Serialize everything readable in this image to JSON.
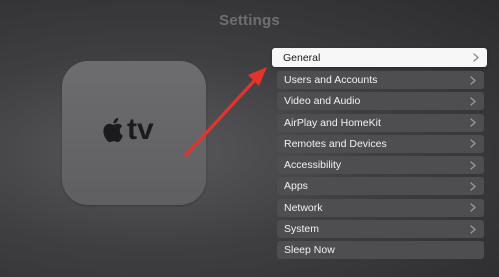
{
  "header": {
    "title": "Settings"
  },
  "device": {
    "text": "tv",
    "logo_icon": "apple-logo-icon"
  },
  "menu": {
    "items": [
      {
        "label": "General",
        "selected": true,
        "has_chevron": true
      },
      {
        "label": "Users and Accounts",
        "selected": false,
        "has_chevron": true
      },
      {
        "label": "Video and Audio",
        "selected": false,
        "has_chevron": true
      },
      {
        "label": "AirPlay and HomeKit",
        "selected": false,
        "has_chevron": true
      },
      {
        "label": "Remotes and Devices",
        "selected": false,
        "has_chevron": true
      },
      {
        "label": "Accessibility",
        "selected": false,
        "has_chevron": true
      },
      {
        "label": "Apps",
        "selected": false,
        "has_chevron": true
      },
      {
        "label": "Network",
        "selected": false,
        "has_chevron": true
      },
      {
        "label": "System",
        "selected": false,
        "has_chevron": true
      },
      {
        "label": "Sleep Now",
        "selected": false,
        "has_chevron": false
      }
    ]
  },
  "annotation": {
    "icon": "red-arrow-icon",
    "color": "#e2342d"
  }
}
